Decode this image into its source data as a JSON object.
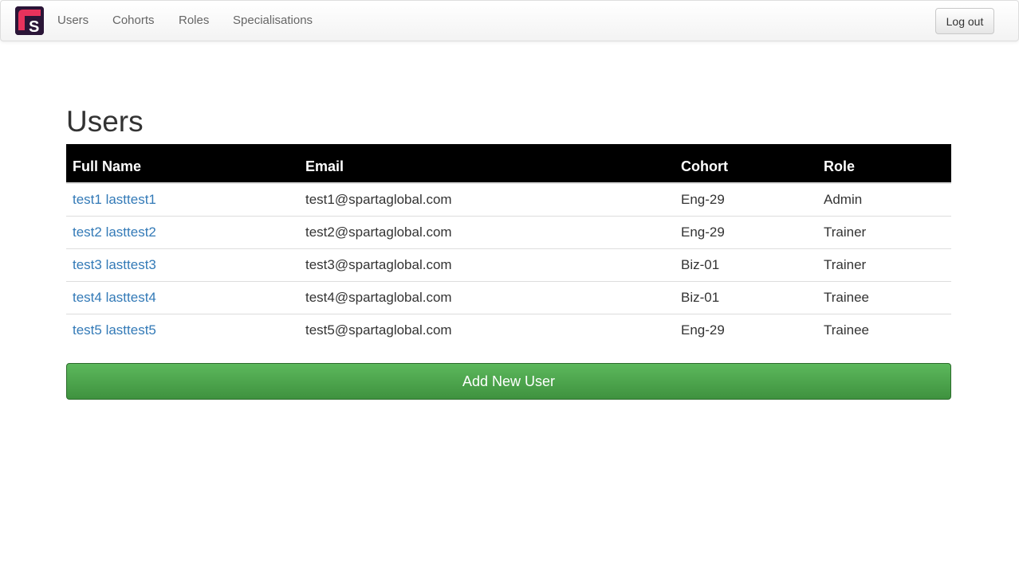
{
  "nav": {
    "items": [
      {
        "label": "Users"
      },
      {
        "label": "Cohorts"
      },
      {
        "label": "Roles"
      },
      {
        "label": "Specialisations"
      }
    ],
    "logout_label": "Log out"
  },
  "colors": {
    "brand_bg": "#2a1537",
    "brand_accent": "#e8325c",
    "link": "#337ab7",
    "header_bg": "#000000",
    "success": "#5cb85c"
  },
  "page": {
    "title": "Users"
  },
  "table": {
    "headers": {
      "full_name": "Full Name",
      "email": "Email",
      "cohort": "Cohort",
      "role": "Role"
    },
    "rows": [
      {
        "name": "test1 lasttest1",
        "email": "test1@spartaglobal.com",
        "cohort": "Eng-29",
        "role": "Admin"
      },
      {
        "name": "test2 lasttest2",
        "email": "test2@spartaglobal.com",
        "cohort": "Eng-29",
        "role": "Trainer"
      },
      {
        "name": "test3 lasttest3",
        "email": "test3@spartaglobal.com",
        "cohort": "Biz-01",
        "role": "Trainer"
      },
      {
        "name": "test4 lasttest4",
        "email": "test4@spartaglobal.com",
        "cohort": "Biz-01",
        "role": "Trainee"
      },
      {
        "name": "test5 lasttest5",
        "email": "test5@spartaglobal.com",
        "cohort": "Eng-29",
        "role": "Trainee"
      }
    ]
  },
  "actions": {
    "add_user_label": "Add New User"
  }
}
